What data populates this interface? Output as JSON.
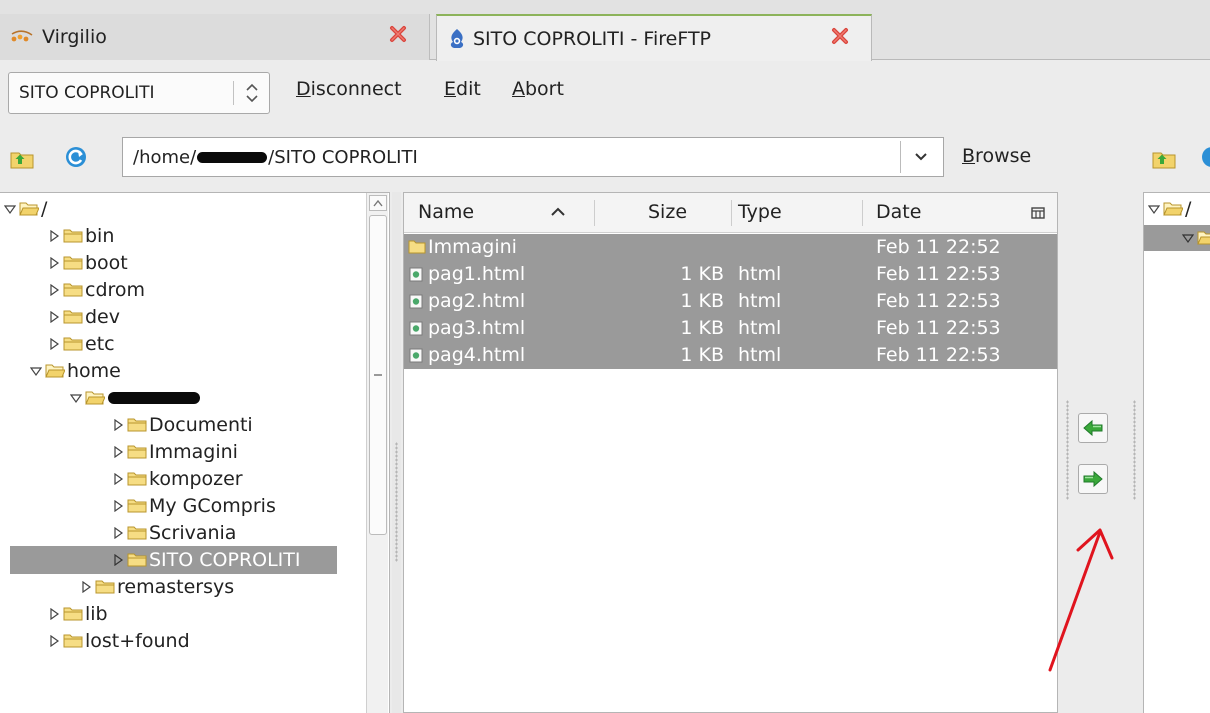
{
  "tabs": [
    {
      "title": "Virgilio"
    },
    {
      "title": "SITO COPROLITI - FireFTP"
    }
  ],
  "toolbar": {
    "profile": "SITO COPROLITI",
    "disconnect": {
      "m": "D",
      "r": "isconnect"
    },
    "edit": {
      "m": "E",
      "r": "dit"
    },
    "abort": {
      "m": "A",
      "r": "bort"
    }
  },
  "pathbar": {
    "path_start": "/home/",
    "path_end": "/SITO COPROLITI",
    "browse": {
      "m": "B",
      "r": "rowse"
    }
  },
  "tree": {
    "root": "/",
    "items": [
      "bin",
      "boot",
      "cdrom",
      "dev",
      "etc",
      "home"
    ],
    "user_children": [
      "Documenti",
      "Immagini",
      "kompozer",
      "My GCompris",
      "Scrivania",
      "SITO COPROLITI"
    ],
    "after_user": [
      "remastersys"
    ],
    "after_home": [
      "lib",
      "lost+found"
    ]
  },
  "file_list": {
    "columns": [
      "Name",
      "Size",
      "Type",
      "Date"
    ],
    "rows": [
      {
        "name": "Immagini",
        "size": "",
        "type": "",
        "date": "Feb 11 22:52"
      },
      {
        "name": "pag1.html",
        "size": "1 KB",
        "type": "html",
        "date": "Feb 11 22:53"
      },
      {
        "name": "pag2.html",
        "size": "1 KB",
        "type": "html",
        "date": "Feb 11 22:53"
      },
      {
        "name": "pag3.html",
        "size": "1 KB",
        "type": "html",
        "date": "Feb 11 22:53"
      },
      {
        "name": "pag4.html",
        "size": "1 KB",
        "type": "html",
        "date": "Feb 11 22:53"
      }
    ]
  },
  "remote": {
    "root": "/"
  },
  "colors": {
    "selection": "#9a9a9a",
    "arrow_green": "#3aa83a",
    "annotation_red": "#e0141e",
    "active_tab_accent": "#8cb35a"
  }
}
